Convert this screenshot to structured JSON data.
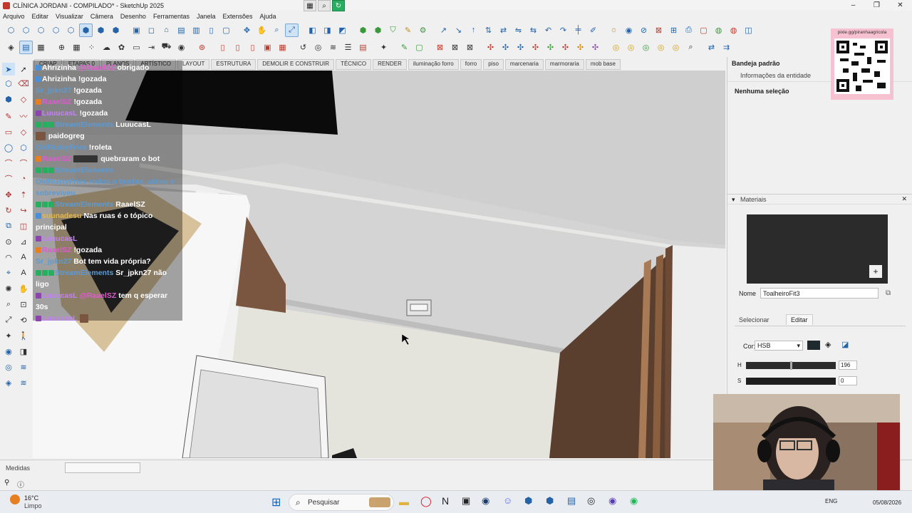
{
  "window": {
    "title": "CLÍNICA JORDANI - COMPILADO* - SketchUp 2025",
    "controls": [
      "–",
      "❐",
      "✕"
    ]
  },
  "menu": [
    "Arquivo",
    "Editar",
    "Visualizar",
    "Câmera",
    "Desenho",
    "Ferramentas",
    "Janela",
    "Extensões",
    "Ajuda"
  ],
  "scene_tabs": [
    "CRIAR",
    "ETAPAS 0",
    "PLANOS",
    "ARTÍSTICO",
    "LAYOUT",
    "ESTRUTURA",
    "DEMOLIR E CONSTRUIR",
    "TÉCNICO",
    "RENDER",
    "iluminação forro",
    "forro",
    "piso",
    "marcenaria",
    "marmoraria",
    "mob base"
  ],
  "tray": {
    "title": "Bandeja padrão",
    "entity_info": "Informações da entidade",
    "selection": "Nenhuma seleção",
    "materials": "Materiais",
    "name_label": "Nome",
    "name_value": "ToalheiroFit3",
    "tab_select": "Selecionar",
    "tab_edit": "Editar",
    "color_label": "Cor:",
    "color_mode": "HSB",
    "h_label": "H",
    "h_value": "196",
    "s_label": "S",
    "s_value": "0",
    "swatch_color": "#1e2a2e"
  },
  "status": {
    "measures_label": "Medidas"
  },
  "overlay": {
    "qr_text": "pixie.gg/piranhaagricola"
  },
  "chat": [
    {
      "user": "Ahrizinha",
      "color": "#ffffff",
      "mention": "@RaaelSZ",
      "msg": "obrigado"
    },
    {
      "user": "Ahrizinha",
      "color": "#ffffff",
      "mention": "",
      "msg": "!gozada"
    },
    {
      "user": "Sr_jpkn27",
      "color": "#5b9bd5",
      "mention": "",
      "msg": "!gozada"
    },
    {
      "user": "RaaelSZ",
      "color": "#e05ad0",
      "mention": "",
      "msg": "!gozada"
    },
    {
      "user": "LuuucasL",
      "color": "#c77dff",
      "mention": "",
      "msg": "!gozada"
    },
    {
      "user": "StreamElements",
      "color": "#5b9bd5",
      "mention": "",
      "msg": "LuuucasL"
    },
    {
      "user": "",
      "color": "#ffffff",
      "mention": "",
      "msg": "paidogreg"
    },
    {
      "user": "OldRustyFries",
      "color": "#5b9bd5",
      "mention": "",
      "msg": "!roleta"
    },
    {
      "user": "RaaelSZ",
      "color": "#e05ad0",
      "mention": "",
      "msg": "quebraram o bot"
    },
    {
      "user": "StreamElements",
      "color": "#5b9bd5",
      "mention": "",
      "msg": ""
    },
    {
      "user": "",
      "color": "#5b9bd5",
      "mention": "",
      "msg": "OldRustyFries rodou o tambor, atirou e sobreviveu"
    },
    {
      "user": "StreamElements",
      "color": "#5b9bd5",
      "mention": "",
      "msg": "RaaelSZ"
    },
    {
      "user": "suunadesu",
      "color": "#e6b84a",
      "mention": "",
      "msg": "Nas ruas é o tópico principal"
    },
    {
      "user": "LuuucasL",
      "color": "#c77dff",
      "mention": "",
      "msg": ""
    },
    {
      "user": "RaaelSZ",
      "color": "#e05ad0",
      "mention": "",
      "msg": "!gozada"
    },
    {
      "user": "Sr_jpkn27",
      "color": "#5b9bd5",
      "mention": "",
      "msg": "Bot tem vida própria?"
    },
    {
      "user": "StreamElements",
      "color": "#5b9bd5",
      "mention": "",
      "msg": "Sr_jpkn27 não ligo"
    },
    {
      "user": "LuuucasL",
      "color": "#c77dff",
      "mention": "@RaaelSZ",
      "msg": "tem q esperar 30s"
    },
    {
      "user": "LuuucasL",
      "color": "#c77dff",
      "mention": "",
      "msg": ""
    }
  ],
  "taskbar": {
    "weather_temp": "16°C",
    "weather_desc": "Limpo",
    "search": "Pesquisar",
    "lang": "ENG",
    "date": "05/08/2026"
  }
}
